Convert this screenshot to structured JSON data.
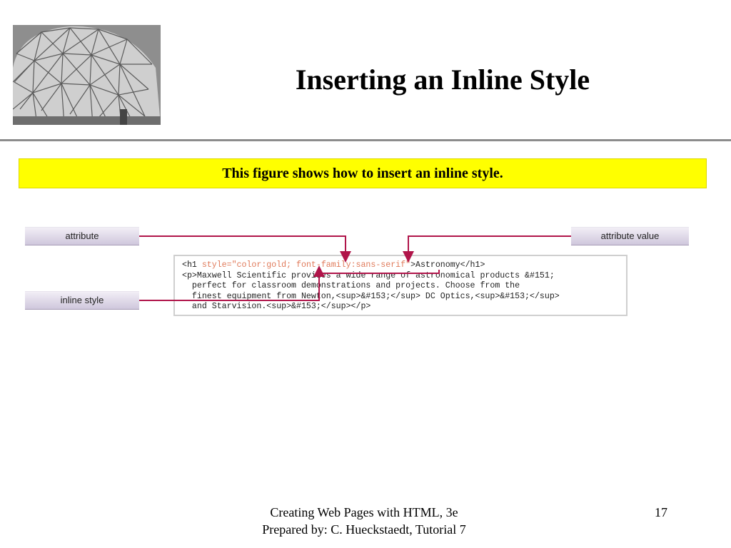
{
  "slide": {
    "title": "Inserting an Inline Style",
    "banner": "This figure shows how to insert an inline style."
  },
  "logo": {
    "icon": "geodesic-dome-photo"
  },
  "figure": {
    "labels": {
      "attribute": "attribute",
      "attribute_value": "attribute value",
      "inline_style": "inline style"
    },
    "code": {
      "line1_pre": "<h1 ",
      "line1_style": "style=\"color:gold; font-family:sans-serif\"",
      "line1_post": ">Astronomy</h1>",
      "line2": "<p>Maxwell Scientific provides a wide range of astronomical products &#151;",
      "line3": "  perfect for classroom demonstrations and projects. Choose from the",
      "line4": "  finest equipment from Newton,<sup>&#153;</sup> DC Optics,<sup>&#153;</sup>",
      "line5": "  and Starvision.<sup>&#153;</sup></p>"
    },
    "arrow_color": "#b0154a",
    "highlight_color": "#e07a5a"
  },
  "footer": {
    "line1": "Creating Web Pages with HTML, 3e",
    "line2": "Prepared by: C. Hueckstaedt, Tutorial 7",
    "page_number": "17"
  }
}
